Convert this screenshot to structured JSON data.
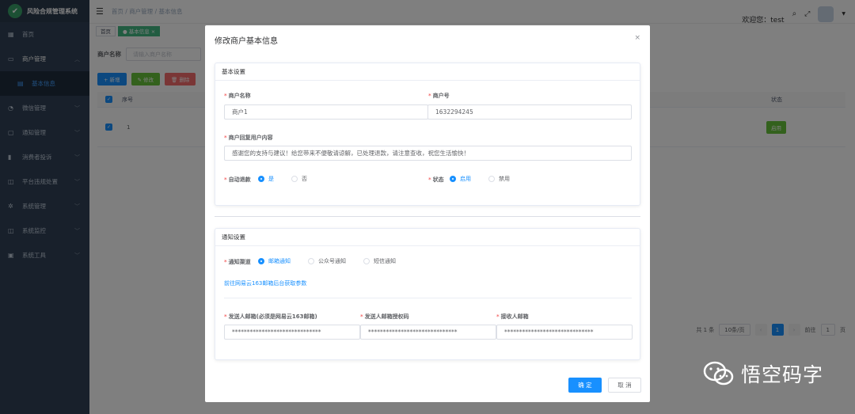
{
  "app": {
    "title": "风险合规管理系统"
  },
  "sidebar": {
    "items": [
      {
        "label": "首页",
        "icon": "dashboard-icon"
      },
      {
        "label": "商户管理",
        "icon": "merchant-icon"
      },
      {
        "label": "基本信息",
        "icon": "grid-icon"
      },
      {
        "label": "微信管理",
        "icon": "wechat-icon"
      },
      {
        "label": "通知管理",
        "icon": "message-icon"
      },
      {
        "label": "消费者投诉",
        "icon": "complaint-icon"
      },
      {
        "label": "平台违规处置",
        "icon": "monitor-icon"
      },
      {
        "label": "系统管理",
        "icon": "gear-icon"
      },
      {
        "label": "系统监控",
        "icon": "monitor-icon"
      },
      {
        "label": "系统工具",
        "icon": "tool-icon"
      }
    ]
  },
  "breadcrumb": {
    "home": "首页",
    "sep1": "/",
    "level1": "商户管理",
    "sep2": "/",
    "current": "基本信息"
  },
  "header": {
    "welcome": "欢迎您：test"
  },
  "tags": {
    "home": "首页",
    "active": "● 基本信息 ×"
  },
  "search": {
    "label": "商户名称",
    "placeholder": "请输入商户名称"
  },
  "toolbar": {
    "add": "+ 新增",
    "edit": "✎ 修改",
    "delete": "🗑 删除"
  },
  "table": {
    "col_index": "序号",
    "col_status": "状态",
    "row_index": "1",
    "row_status": "启用"
  },
  "pagination": {
    "total": "共 1 条",
    "page_size": "10条/页",
    "page": "1",
    "goto": "前往",
    "goto_value": "1",
    "page_unit": "页"
  },
  "dialog": {
    "title": "修改商户基本信息",
    "basic": {
      "header": "基本设置",
      "name_label": "商户名称",
      "name_value": "商户1",
      "no_label": "商户号",
      "no_value": "1632294245",
      "reply_label": "商户回复用户内容",
      "reply_value": "感谢您的支持与建议！给您带来不便敬请谅解，已处理退款，请注意查收，祝您生活愉快！",
      "auto_refund_label": "自动退款",
      "auto_refund_yes": "是",
      "auto_refund_no": "否",
      "status_label": "状态",
      "status_on": "启用",
      "status_off": "禁用"
    },
    "notify": {
      "header": "通知设置",
      "channel_label": "通知渠道",
      "channel_email": "邮箱通知",
      "channel_official": "公众号通知",
      "channel_sms": "短信通知",
      "link": "前往网易云163邮箱后台获取参数",
      "sender_label": "发送人邮箱(必须是网易云163邮箱)",
      "sender_value": "******************************",
      "auth_label": "发送人邮箱授权码",
      "auth_value": "******************************",
      "receiver_label": "接收人邮箱",
      "receiver_value": "******************************"
    },
    "ok": "确 定",
    "cancel": "取 消"
  },
  "watermark": {
    "text": "悟空码字"
  }
}
